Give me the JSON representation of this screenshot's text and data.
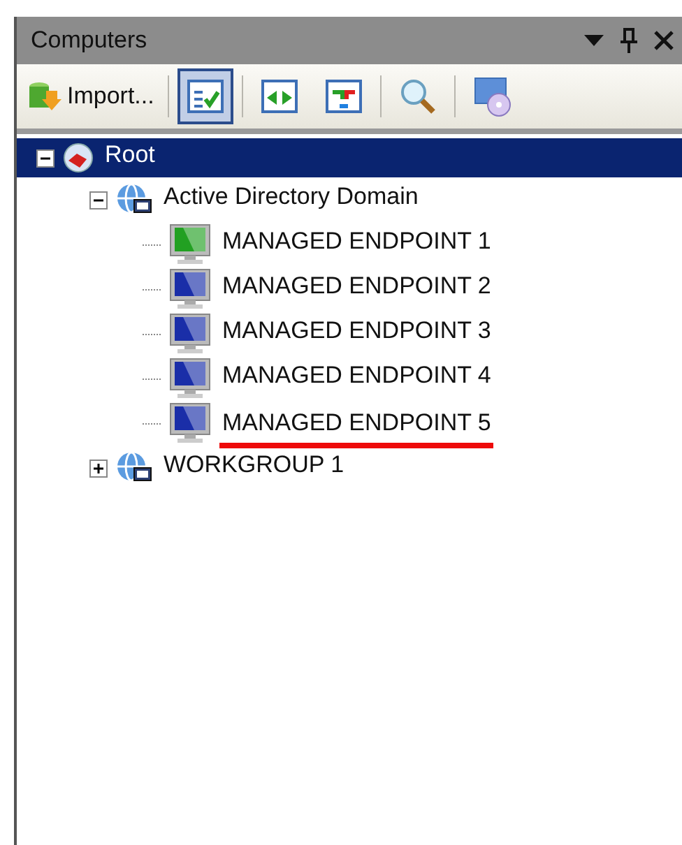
{
  "panel": {
    "title": "Computers"
  },
  "toolbar": {
    "import_label": "Import...",
    "button_groups": [
      [
        {
          "kind": "checklist",
          "pressed": true
        }
      ],
      [
        {
          "kind": "arrows",
          "pressed": false
        },
        {
          "kind": "swap",
          "pressed": false
        }
      ],
      [
        {
          "kind": "search",
          "pressed": false
        }
      ],
      [
        {
          "kind": "disc",
          "pressed": false
        }
      ]
    ]
  },
  "tree": [
    {
      "label": "Root",
      "kind": "root",
      "selected": true,
      "expanded": true,
      "children": [
        {
          "label": "Active Directory Domain",
          "kind": "domain",
          "selected": false,
          "expanded": true,
          "children": [
            {
              "label": "MANAGED ENDPOINT 1",
              "kind": "endpoint",
              "selected": false,
              "color": "#22a022",
              "underlined": false
            },
            {
              "label": "MANAGED ENDPOINT 2",
              "kind": "endpoint",
              "selected": false,
              "color": "#1a2ea8",
              "underlined": false
            },
            {
              "label": "MANAGED ENDPOINT 3",
              "kind": "endpoint",
              "selected": false,
              "color": "#1a2ea8",
              "underlined": false
            },
            {
              "label": "MANAGED ENDPOINT 4",
              "kind": "endpoint",
              "selected": false,
              "color": "#1a2ea8",
              "underlined": false
            },
            {
              "label": "MANAGED ENDPOINT 5",
              "kind": "endpoint",
              "selected": false,
              "color": "#1a2ea8",
              "underlined": true
            }
          ]
        },
        {
          "label": "WORKGROUP 1",
          "kind": "domain",
          "selected": false,
          "expanded": false
        }
      ]
    }
  ]
}
